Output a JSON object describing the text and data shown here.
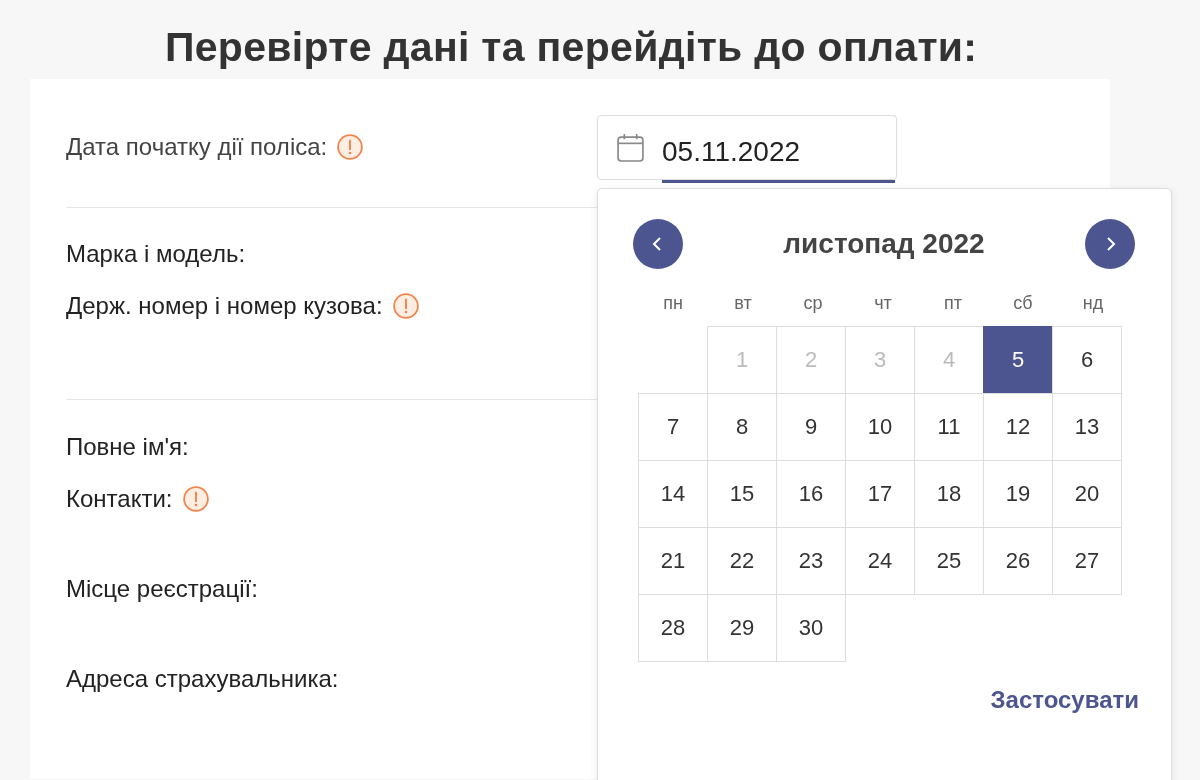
{
  "heading": "Перевірте дані та перейдіть до оплати:",
  "sections": [
    [
      {
        "label": "Дата початку дії поліса:",
        "warning": true
      }
    ],
    [
      {
        "label": "Марка і модель:",
        "warning": false
      },
      {
        "label": "Держ. номер і номер кузова:",
        "warning": true
      }
    ],
    [
      {
        "label": "Повне ім'я:",
        "warning": false
      },
      {
        "label": "Контакти:",
        "warning": true
      },
      {
        "label": "Місце реєстрації:",
        "warning": false
      },
      {
        "label": "Адреса страхувальника:",
        "warning": false
      }
    ]
  ],
  "date_field": {
    "value": "05.11.2022"
  },
  "calendar": {
    "month": "листопад 2022",
    "weekdays": [
      "пн",
      "вт",
      "ср",
      "чт",
      "пт",
      "сб",
      "нд"
    ],
    "weeks": [
      [
        {
          "day": "1",
          "disabled": true,
          "selected": false
        },
        {
          "day": "2",
          "disabled": true,
          "selected": false
        },
        {
          "day": "3",
          "disabled": true,
          "selected": false
        },
        {
          "day": "4",
          "disabled": true,
          "selected": false
        },
        {
          "day": "5",
          "disabled": false,
          "selected": true
        },
        {
          "day": "6",
          "disabled": false,
          "selected": false
        }
      ],
      [
        {
          "day": "7",
          "disabled": false,
          "selected": false
        },
        {
          "day": "8",
          "disabled": false,
          "selected": false
        },
        {
          "day": "9",
          "disabled": false,
          "selected": false
        },
        {
          "day": "10",
          "disabled": false,
          "selected": false
        },
        {
          "day": "11",
          "disabled": false,
          "selected": false
        },
        {
          "day": "12",
          "disabled": false,
          "selected": false
        },
        {
          "day": "13",
          "disabled": false,
          "selected": false
        }
      ],
      [
        {
          "day": "14",
          "disabled": false,
          "selected": false
        },
        {
          "day": "15",
          "disabled": false,
          "selected": false
        },
        {
          "day": "16",
          "disabled": false,
          "selected": false
        },
        {
          "day": "17",
          "disabled": false,
          "selected": false
        },
        {
          "day": "18",
          "disabled": false,
          "selected": false
        },
        {
          "day": "19",
          "disabled": false,
          "selected": false
        },
        {
          "day": "20",
          "disabled": false,
          "selected": false
        }
      ],
      [
        {
          "day": "21",
          "disabled": false,
          "selected": false
        },
        {
          "day": "22",
          "disabled": false,
          "selected": false
        },
        {
          "day": "23",
          "disabled": false,
          "selected": false
        },
        {
          "day": "24",
          "disabled": false,
          "selected": false
        },
        {
          "day": "25",
          "disabled": false,
          "selected": false
        },
        {
          "day": "26",
          "disabled": false,
          "selected": false
        },
        {
          "day": "27",
          "disabled": false,
          "selected": false
        }
      ],
      [
        {
          "day": "28",
          "disabled": false,
          "selected": false
        },
        {
          "day": "29",
          "disabled": false,
          "selected": false
        },
        {
          "day": "30",
          "disabled": false,
          "selected": false
        }
      ]
    ],
    "apply": "Застосувати"
  }
}
